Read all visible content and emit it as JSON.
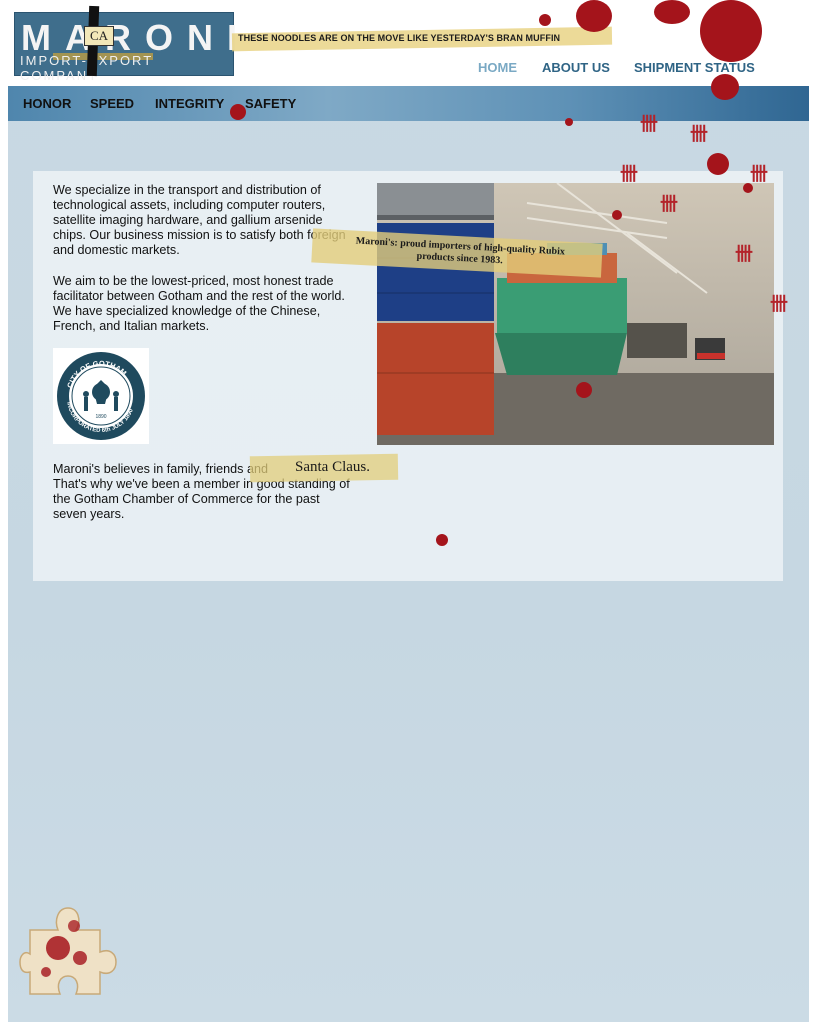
{
  "brand": {
    "name": "MARONI",
    "subtitle": "IMPORT-EXPORT COMPANY",
    "overlay_letters": "CA"
  },
  "tagline": "THESE NOODLES ARE ON THE MOVE LIKE YESTERDAY'S BRAN MUFFIN",
  "top_nav": {
    "home": "HOME",
    "about": "ABOUT US",
    "shipment": "SHIPMENT STATUS"
  },
  "values_bar": [
    "HONOR",
    "SPEED",
    "INTEGRITY",
    "SAFETY"
  ],
  "content": {
    "para1": "We specialize in the transport and distribution of technological assets, including computer routers, satellite imaging hardware, and gallium arsenide chips. Our business mission is to satisfy both foreign and domestic markets.",
    "para2": "We aim to be the lowest-priced, most honest trade facilitator between Gotham and the rest of the world. We have specialized knowledge of the Chinese, French, and Italian markets.",
    "para3": "Maroni's believes in family, friends and",
    "para3_tail": "That's why we've been a member in good standing of the Gotham Chamber of Commerce for the past seven years.",
    "santa": "Santa Claus.",
    "photo_caption": "Maroni's: proud importers of high-quality Rubix products since 1983."
  },
  "seal": {
    "top_text": "CITY OF GOTHAM",
    "bottom_text": "INCORPORATED 6th JULY 1890",
    "year": "1890"
  },
  "colors": {
    "link_active": "#7aa9c4",
    "link": "#2f6485",
    "blood": "#a4141b",
    "tape": "#e2cd7b"
  }
}
